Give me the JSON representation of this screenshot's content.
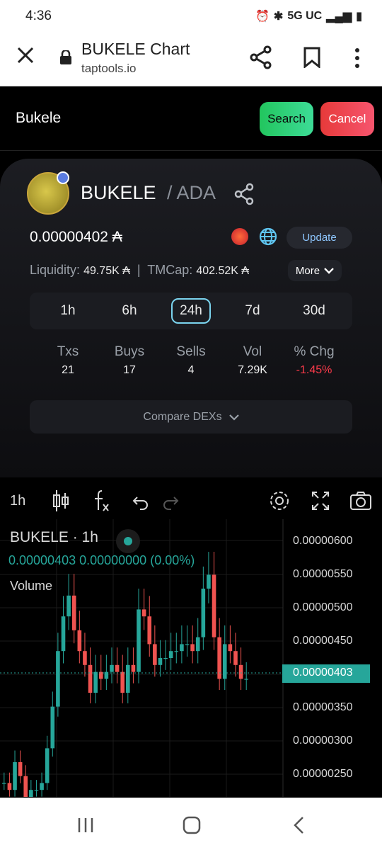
{
  "status_bar": {
    "time": "4:36",
    "network": "5G UC"
  },
  "browser": {
    "title": "BUKELE Chart",
    "url": "taptools.io"
  },
  "search": {
    "label": "Bukele",
    "search_label": "Search",
    "cancel_label": "Cancel"
  },
  "token": {
    "name": "BUKELE",
    "pair": "/ ADA",
    "price": "0.00000402 ₳",
    "update_label": "Update",
    "liquidity_label": "Liquidity:",
    "liquidity_value": "49.75K ₳",
    "separator": "|",
    "tmcap_label": "TMCap:",
    "tmcap_value": "402.52K ₳",
    "more_label": "More"
  },
  "timeframes": [
    {
      "label": "1h"
    },
    {
      "label": "6h"
    },
    {
      "label": "24h",
      "active": true
    },
    {
      "label": "7d"
    },
    {
      "label": "30d"
    }
  ],
  "stats": [
    {
      "label": "Txs",
      "value": "21"
    },
    {
      "label": "Buys",
      "value": "17"
    },
    {
      "label": "Sells",
      "value": "4"
    },
    {
      "label": "Vol",
      "value": "7.29K"
    },
    {
      "label": "% Chg",
      "value": "-1.45%",
      "negative": true
    }
  ],
  "compare_label": "Compare DEXs",
  "chart": {
    "interval": "1h",
    "legend": "BUKELE · 1h",
    "ohlc_line": "0.00000403  0.00000000 (0.00%)",
    "volume_label": "Volume",
    "current_price": "0.00000403",
    "axis": [
      "0.00000600",
      "0.00000550",
      "0.00000500",
      "0.00000450",
      "0.00000350",
      "0.00000300",
      "0.00000250"
    ],
    "up_color": "#26a69a",
    "down_color": "#ef5350"
  },
  "chart_data": {
    "type": "candlestick",
    "title": "BUKELE · 1h",
    "ylabel": "",
    "ylim": [
      2.3e-06,
      6.3e-06
    ],
    "close_series": [
      2.5e-06,
      2.4e-06,
      2.8e-06,
      2.6e-06,
      2.3e-06,
      2.4e-06,
      2.4e-06,
      2.5e-06,
      3e-06,
      3.6e-06,
      4.4e-06,
      4.9e-06,
      5.2e-06,
      4.7e-06,
      4.4e-06,
      4.2e-06,
      3.8e-06,
      4.1e-06,
      4e-06,
      4.1e-06,
      4.2e-06,
      4.1e-06,
      3.8e-06,
      4.2e-06,
      4.1e-06,
      5e-06,
      4.9e-06,
      4.5e-06,
      4.2e-06,
      4.3e-06,
      4.3e-06,
      4.4e-06,
      4.4e-06,
      4.5e-06,
      4.5e-06,
      4.4e-06,
      4.6e-06,
      5.3e-06,
      5.5e-06,
      4.6e-06,
      4e-06,
      4.5e-06,
      4.4e-06,
      4.2e-06,
      4e-06,
      4e-06
    ]
  }
}
